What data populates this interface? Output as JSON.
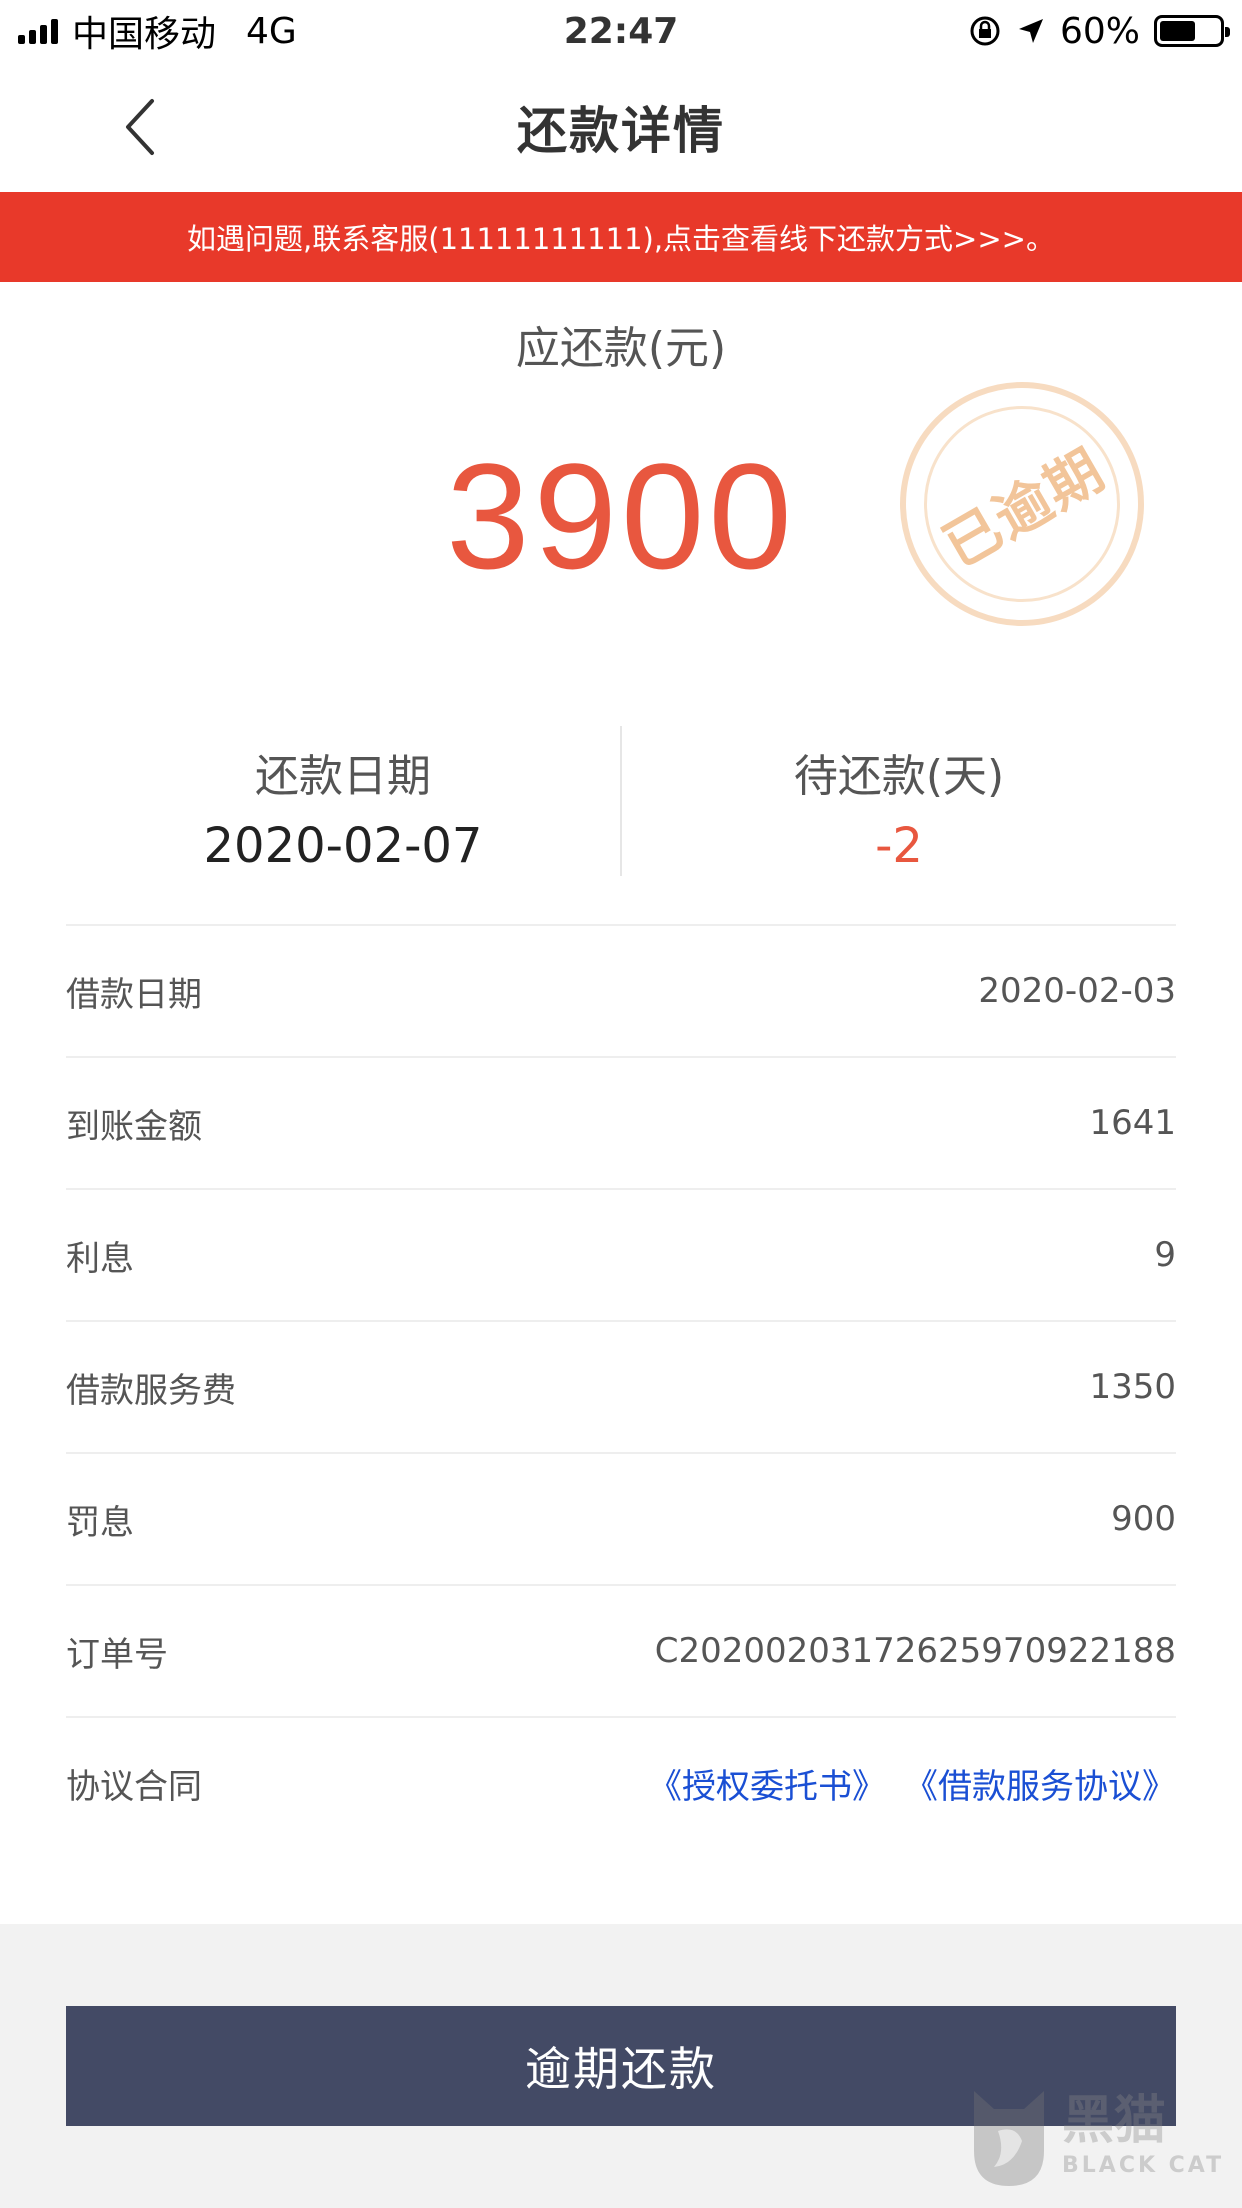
{
  "status_bar": {
    "carrier": "中国移动",
    "network": "4G",
    "time": "22:47",
    "battery": "60%",
    "battery_level": 0.6
  },
  "nav": {
    "title": "还款详情",
    "back_icon": "chevron-left-icon"
  },
  "notice": {
    "text": "如遇问题,联系客服(11111111111),点击查看线下还款方式>>>。",
    "color": "#e8392a"
  },
  "amount": {
    "label": "应还款(元)",
    "value": "3900",
    "color": "#e8573f"
  },
  "stamp": {
    "text": "已逾期"
  },
  "summary": {
    "repay_date_label": "还款日期",
    "repay_date_value": "2020-02-07",
    "days_left_label": "待还款(天)",
    "days_left_value": "-2"
  },
  "details": [
    {
      "label": "借款日期",
      "value": "2020-02-03"
    },
    {
      "label": "到账金额",
      "value": "1641"
    },
    {
      "label": "利息",
      "value": "9"
    },
    {
      "label": "借款服务费",
      "value": "1350"
    },
    {
      "label": "罚息",
      "value": "900"
    },
    {
      "label": "订单号",
      "value": "C202002031726259709221​88"
    }
  ],
  "contract": {
    "label": "协议合同",
    "links": [
      "《授权委托书》",
      "《借款服务协议》"
    ]
  },
  "footer": {
    "button_label": "逾期还款",
    "button_color": "#434a65"
  },
  "watermark": {
    "cn": "黑猫",
    "en": "BLACK CAT"
  }
}
